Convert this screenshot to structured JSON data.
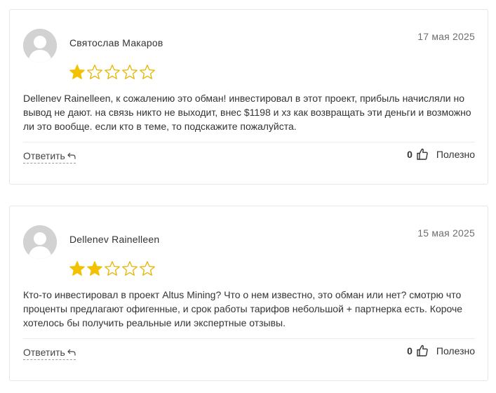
{
  "reviews": [
    {
      "author": "Святослав Макаров",
      "date": "17 мая 2025",
      "rating": 1,
      "max_rating": 5,
      "text": "Dellenev Rainelleen, к сожалению это обман! инвестировал в этот проект, прибыль начисляли но вывод не дают. на связь никто не выходит, внес $1198 и хз как возвращать эти деньги и возможно ли это вообще. если кто в теме, то подскажите пожалуйста.",
      "reply_label": "Ответить",
      "likes": "0",
      "helpful_label": "Полезно"
    },
    {
      "author": "Dellenev Rainelleen",
      "date": "15 мая 2025",
      "rating": 2,
      "max_rating": 5,
      "text": "Кто-то инвестировал в проект Altus Mining? Что о нем известно, это обман или нет? смотрю что проценты предлагают офигенные, и срок работы тарифов небольшой + партнерка есть. Короче хотелось бы получить реальные или экспертные отзывы.",
      "reply_label": "Ответить",
      "likes": "0",
      "helpful_label": "Полезно"
    }
  ],
  "colors": {
    "star_filled": "#f2c200",
    "star_empty_stroke": "#e8b500",
    "avatar_bg": "#d2d2d2",
    "avatar_fg": "#ffffff"
  },
  "icons": {
    "avatar": "user-silhouette-icon",
    "star": "star-icon",
    "reply": "reply-arrow-icon",
    "like": "thumbs-up-icon"
  }
}
